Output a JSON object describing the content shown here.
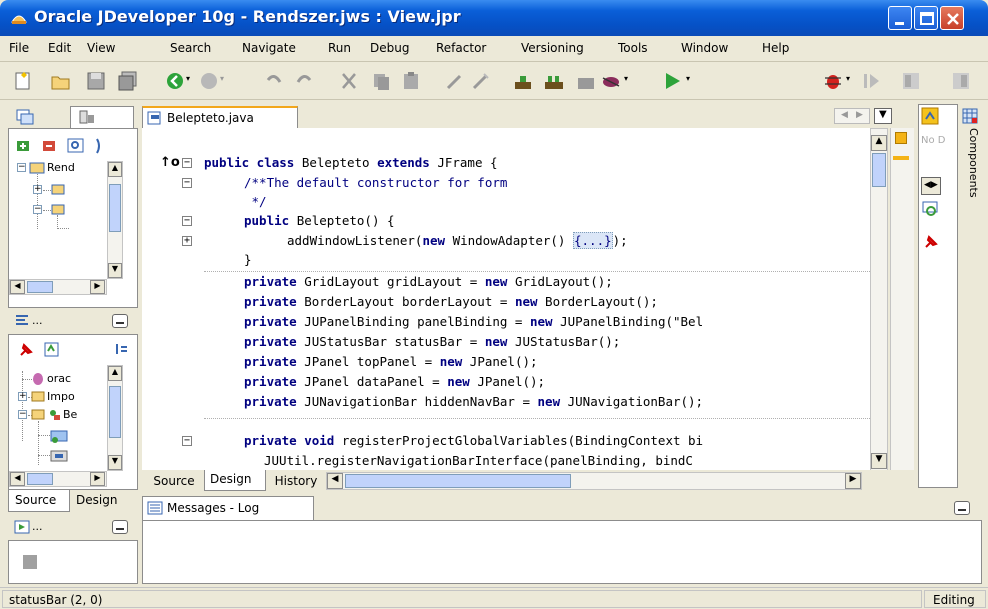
{
  "window": {
    "title": "Oracle JDeveloper 10g - Rendszer.jws : View.jpr"
  },
  "menu": [
    "File",
    "Edit",
    "View",
    "Search",
    "Navigate",
    "Run",
    "Debug",
    "Refactor",
    "Versioning",
    "Tools",
    "Window",
    "Help"
  ],
  "editor": {
    "tab_label": "Belepteto.java",
    "bottom_tabs": [
      "Source",
      "Design",
      "History"
    ],
    "active_bottom_tab": "Design"
  },
  "code": [
    {
      "kw1": "public class ",
      "plain1": "Belepteto ",
      "kw2": "extends ",
      "plain2": "JFrame {"
    },
    {
      "comment": "/**The default constructor for form"
    },
    {
      "comment": " */"
    },
    {
      "kw1": "public ",
      "plain1": "Belepteto() {"
    },
    {
      "plain1": "addWindowListener(",
      "kw1": "new ",
      "plain2": "WindowAdapter() ",
      "fold": "{...}",
      "plain3": ");"
    },
    {
      "plain1": "}"
    },
    {
      "kw1": "private ",
      "plain1": "GridLayout gridLayout = ",
      "kw2": "new ",
      "plain2": "GridLayout();"
    },
    {
      "kw1": "private ",
      "plain1": "BorderLayout borderLayout = ",
      "kw2": "new ",
      "plain2": "BorderLayout();"
    },
    {
      "kw1": "private ",
      "plain1": "JUPanelBinding panelBinding = ",
      "kw2": "new ",
      "plain2": "JUPanelBinding(\"Bel"
    },
    {
      "kw1": "private ",
      "plain1": "JUStatusBar statusBar = ",
      "kw2": "new ",
      "plain2": "JUStatusBar();"
    },
    {
      "kw1": "private ",
      "plain1": "JPanel topPanel = ",
      "kw2": "new ",
      "plain2": "JPanel();"
    },
    {
      "kw1": "private ",
      "plain1": "JPanel dataPanel = ",
      "kw2": "new ",
      "plain2": "JPanel();"
    },
    {
      "kw1": "private ",
      "plain1": "JUNavigationBar hiddenNavBar = ",
      "kw2": "new ",
      "plain2": "JUNavigationBar();"
    },
    {
      "kw1": "private void ",
      "plain1": "registerProjectGlobalVariables(BindingContext bi"
    },
    {
      "plain1": "JUUtil.registerNavigationBarInterface(panelBinding, bindC"
    }
  ],
  "app_nav": {
    "tree_items": [
      "Rend"
    ]
  },
  "structure": {
    "header_label": "...",
    "tree_items": [
      "orac",
      "Impo",
      "Be"
    ],
    "bottom_tabs": [
      "Source",
      "Design"
    ]
  },
  "log_panel": {
    "title": "Messages - Log"
  },
  "small_panel": {
    "label": "..."
  },
  "right_panel": {
    "no_data_label": "No D",
    "components_label": "Components"
  },
  "status": {
    "left": "statusBar (2, 0)",
    "right": "Editing"
  }
}
